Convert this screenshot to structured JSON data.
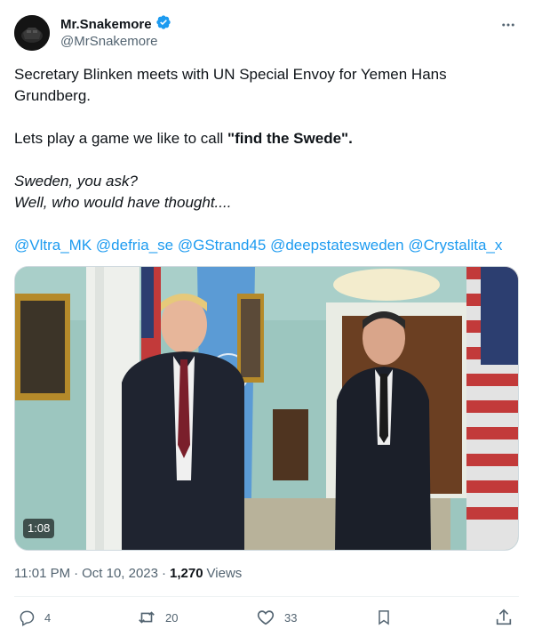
{
  "author": {
    "display_name": "Mr.Snakemore",
    "handle": "@MrSnakemore",
    "verified": true,
    "verified_color": "#1d9bf0"
  },
  "tweet": {
    "line1": "Secretary Blinken meets with UN Special Envoy for Yemen Hans Grundberg.",
    "line2_prefix": "Lets play a game we like to call ",
    "line2_bold": "\"find the Swede\".",
    "line3": "Sweden, you ask?",
    "line4": "Well, who would have thought....",
    "mentions": [
      "@Vltra_MK",
      "@defria_se",
      "@GStrand45",
      "@deepstatesweden",
      "@Crystalita_x"
    ]
  },
  "media": {
    "duration": "1:08"
  },
  "meta": {
    "time": "11:01 PM",
    "sep1": "·",
    "date": "Oct 10, 2023",
    "sep2": "·",
    "views_count": "1,270",
    "views_label": "Views"
  },
  "actions": {
    "replies": "4",
    "retweets": "20",
    "likes": "33"
  },
  "icons": {
    "more": "more-horizontal-icon",
    "reply": "reply-icon",
    "retweet": "retweet-icon",
    "like": "heart-icon",
    "bookmark": "bookmark-icon",
    "share": "share-icon",
    "verified": "verified-badge-icon"
  },
  "colors": {
    "text": "#0f1419",
    "muted": "#536471",
    "link": "#1d9bf0"
  }
}
